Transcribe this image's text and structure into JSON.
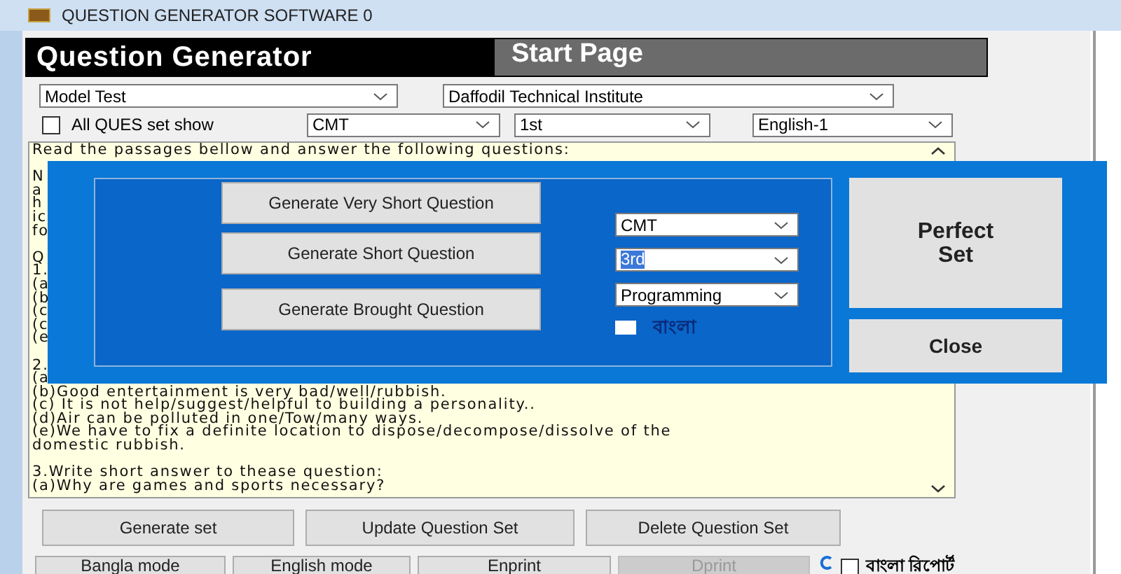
{
  "window": {
    "title": "QUESTION GENERATOR SOFTWARE 0"
  },
  "header": {
    "title": "Question Generator",
    "page": "Start Page"
  },
  "filters_row_1": [
    {
      "value": "Model Test"
    },
    {
      "value": "Daffodil Technical Institute"
    }
  ],
  "all_ques_set_show": {
    "label": "All QUES set show",
    "checked": false
  },
  "filters_row_2": [
    {
      "value": "CMT"
    },
    {
      "value": "1st"
    },
    {
      "value": "English-1"
    }
  ],
  "passage": {
    "paragraphs": [
      [
        "Read the passages bellow and answer the following questions:"
      ],
      [
        "N",
        "a",
        "h",
        "ic",
        "fo"
      ],
      [
        "Q",
        "1.",
        "(a",
        "(b",
        "(c",
        "(c",
        "(e"
      ],
      [
        "2.",
        "(a",
        "(b)Good entertainment is very bad/well/rubbish.",
        "(c) It is not help/suggest/helpful to building a personality..",
        "(d)Air can be polluted in one/Tow/many ways.",
        "(e)We have to fix a definite location to dispose/decompose/dissolve of the",
        "domestic rubbish."
      ],
      [
        "3.Write short answer to thease question:",
        "(a)Why are games and sports necessary?"
      ]
    ]
  },
  "dialog": {
    "generate_buttons": [
      "Generate Very Short Question",
      "Generate Short Question",
      "Generate Brought Question"
    ],
    "dropdowns": [
      {
        "value": "CMT",
        "highlighted": false
      },
      {
        "value": "3rd",
        "highlighted": true
      },
      {
        "value": "Programming",
        "highlighted": false
      }
    ],
    "bangla": {
      "label": "বাংলা",
      "checked": false
    },
    "perfect_set": "Perfect Set",
    "close": "Close"
  },
  "actions": [
    "Generate set",
    "Update Question Set",
    "Delete Question Set"
  ],
  "bottom_buttons": [
    {
      "label": "Bangla mode",
      "disabled": false
    },
    {
      "label": "English mode",
      "disabled": false
    },
    {
      "label": "Enprint",
      "disabled": false
    },
    {
      "label": "Dprint",
      "disabled": true
    }
  ],
  "bangla_report": {
    "label": "বাংলা রিপোর্ট",
    "checked": false
  }
}
